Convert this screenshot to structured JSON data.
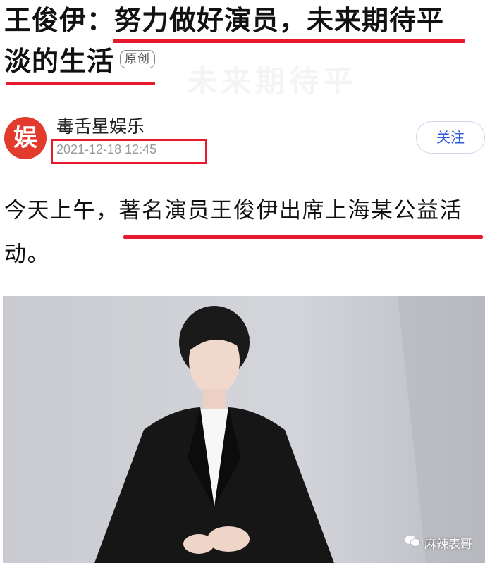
{
  "article": {
    "title_part1": "王俊伊：",
    "title_part2": "努力做好演员，未来期待平",
    "title_part3": "淡的生活",
    "badge": "原创"
  },
  "author": {
    "avatar_char": "娱",
    "name": "毒舌星娱乐",
    "date": "2021-12-18 12:45",
    "follow_label": "关注"
  },
  "body": {
    "text_part1": "今天上午，",
    "text_part2": "著名演员王俊伊出席上海某公益活",
    "text_part3": "动。"
  },
  "photo": {
    "watermark": "麻辣表哥"
  },
  "colors": {
    "highlight_red": "#e8192c",
    "follow_blue": "#2a5bd7",
    "avatar_red": "#e23a2c"
  }
}
